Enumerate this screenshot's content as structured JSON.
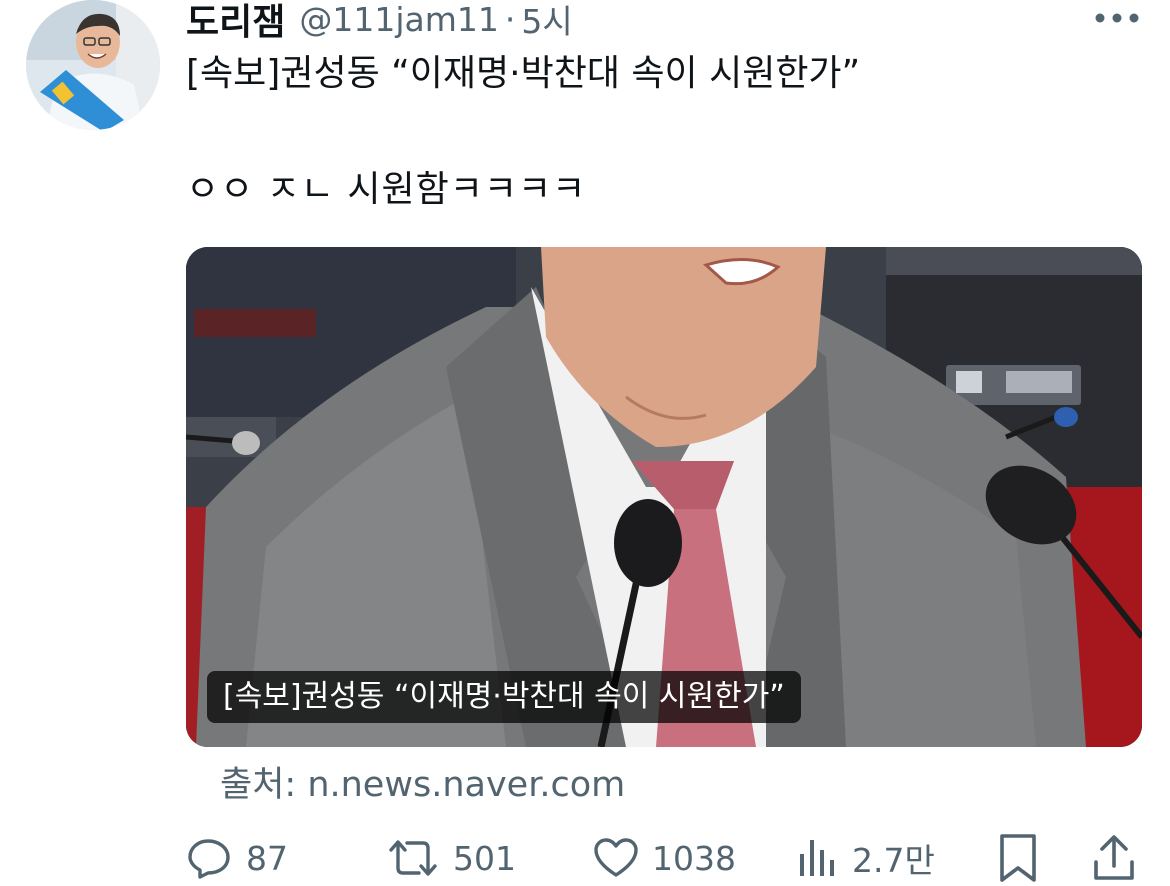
{
  "tweet": {
    "display_name": "도리잼",
    "handle": "@111jam11",
    "separator": "·",
    "time": "5시",
    "headline": "[속보]권성동 “이재명·박찬대 속이 시원한가”",
    "comment": "ㅇㅇ ㅈㄴ 시원함ㅋㅋㅋㅋ"
  },
  "card": {
    "caption": "[속보]권성동 “이재명·박찬대 속이 시원한가”",
    "source": "출처: n.news.naver.com"
  },
  "actions": {
    "replies": "87",
    "retweets": "501",
    "likes": "1038",
    "views": "2.7만"
  },
  "colors": {
    "text": "#0f1419",
    "muted": "#536471"
  },
  "icons": {
    "more": "more-dots-icon",
    "reply": "reply-icon",
    "retweet": "retweet-icon",
    "like": "heart-icon",
    "views": "views-icon",
    "bookmark": "bookmark-icon",
    "share": "share-icon"
  }
}
